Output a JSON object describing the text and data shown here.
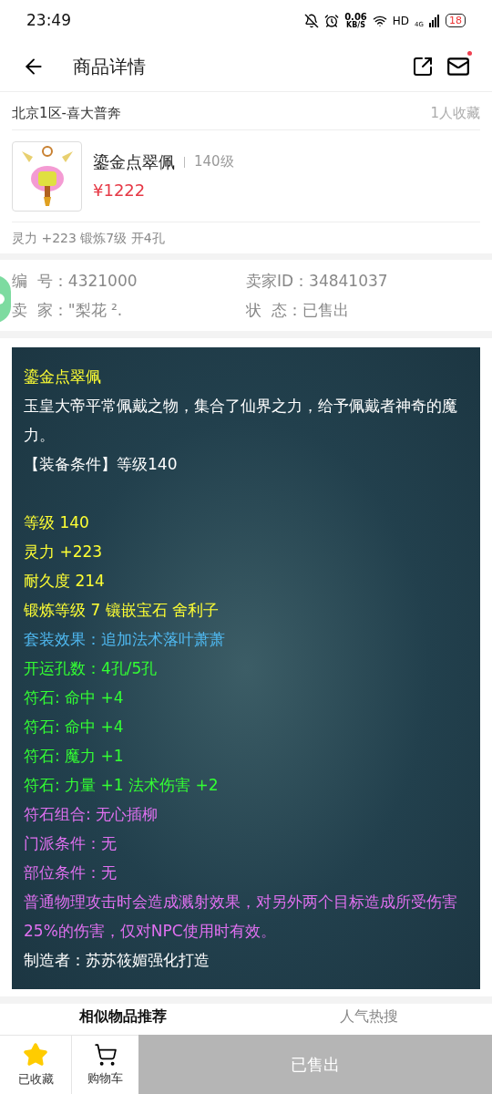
{
  "status_bar": {
    "time": "23:49",
    "speed": "0.06",
    "speed_unit": "KB/S",
    "network": "HD",
    "cell": "4G",
    "battery": "18"
  },
  "header": {
    "title": "商品详情",
    "has_notification": true
  },
  "server": {
    "name": "北京1区-喜大普奔",
    "favorites": "1人收藏"
  },
  "item": {
    "name": "鎏金点翠佩",
    "level": "140级",
    "price": "¥1222",
    "summary": "灵力 +223 锻炼7级 开4孔"
  },
  "info": [
    {
      "label": "编  号：",
      "value": "4321000"
    },
    {
      "label": "卖家ID：",
      "value": "34841037"
    },
    {
      "label": "卖  家：",
      "value": "\"梨花 ²."
    },
    {
      "label": "状  态：",
      "value": "已售出"
    }
  ],
  "description": {
    "intro": [
      {
        "text": "鎏金点翠佩",
        "color": "#ffff33"
      },
      {
        "text": "玉皇大帝平常佩戴之物，集合了仙界之力，给予佩戴者神奇的魔力。",
        "color": "#ffffff"
      },
      {
        "text": "【装备条件】等级140",
        "color": "#ffffff"
      }
    ],
    "attributes": [
      {
        "text": "等级 140",
        "color": "#ffff33"
      },
      {
        "text": "灵力 +223",
        "color": "#ffff33"
      },
      {
        "text": "耐久度 214",
        "color": "#ffff33"
      },
      {
        "text": "锻炼等级 7 镶嵌宝石 舍利子",
        "color": "#ffff33"
      },
      {
        "text": "套装效果：追加法术落叶萧萧",
        "color": "#4fb8f0"
      },
      {
        "text": "开运孔数：4孔/5孔",
        "color": "#33ff33"
      },
      {
        "text": "符石: 命中 +4",
        "color": "#33ff33"
      },
      {
        "text": "符石: 命中 +4",
        "color": "#33ff33"
      },
      {
        "text": "符石: 魔力 +1",
        "color": "#33ff33"
      },
      {
        "text": "符石: 力量 +1 法术伤害 +2",
        "color": "#33ff33"
      },
      {
        "text": "符石组合: 无心插柳",
        "color": "#e070f0"
      },
      {
        "text": "门派条件：无",
        "color": "#e070f0"
      },
      {
        "text": "部位条件：无",
        "color": "#e070f0"
      },
      {
        "text": "普通物理攻击时会造成溅射效果，对另外两个目标造成所受伤害25%的伤害，仅对NPC使用时有效。",
        "color": "#e070f0"
      },
      {
        "text": "制造者：苏苏筱媚强化打造",
        "color": "#ffffff"
      }
    ]
  },
  "tabs": [
    {
      "label": "相似物品推荐",
      "selected": true
    },
    {
      "label": "人气热搜",
      "selected": false
    }
  ],
  "bottom_bar": {
    "favorite": {
      "label": "已收藏",
      "checked": true
    },
    "cart": "购物车",
    "action": {
      "label": "已售出",
      "disabled": true
    }
  }
}
